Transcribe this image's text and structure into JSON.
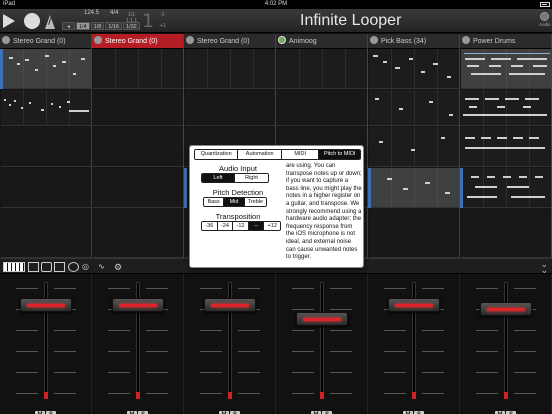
{
  "status_bar": {
    "carrier": "iPad",
    "time": "4:02 PM"
  },
  "transport": {
    "tempo": "124.5",
    "meter": "4/4",
    "quantize_options": [
      "1/4",
      "1/8",
      "1/16",
      "1/32"
    ],
    "quantize_selected": "1/4",
    "position_small": [
      "1/1",
      "1.1.1",
      "1"
    ],
    "position_big": "1",
    "length_labels": [
      "-1",
      "+1"
    ],
    "app_title": "Infinite Looper",
    "audio_label": "Audio"
  },
  "tracks": [
    {
      "name": "Stereo Grand (0)",
      "active": false,
      "icon": "gear-icon"
    },
    {
      "name": "Stereo Grand (0)",
      "active": true,
      "icon": "gear-icon"
    },
    {
      "name": "Stereo Grand (0)",
      "active": false,
      "icon": "gear-icon"
    },
    {
      "name": "Animoog",
      "active": false,
      "icon": "animoog-app-icon"
    },
    {
      "name": "Pick Bass (34)",
      "active": false,
      "icon": "gear-icon"
    },
    {
      "name": "Power Drums",
      "active": false,
      "icon": "gear-icon"
    }
  ],
  "popover": {
    "tabs": [
      "Quantization",
      "Automation",
      "MIDI",
      "Pitch to MIDI"
    ],
    "selected_tab": "Pitch to MIDI",
    "audio_input_label": "Audio Input",
    "audio_input_options": [
      "Left",
      "Right"
    ],
    "audio_input_selected": "Left",
    "pitch_detection_label": "Pitch Detection",
    "pitch_detection_options": [
      "Bass",
      "Mid",
      "Treble"
    ],
    "pitch_detection_selected": "Mid",
    "transposition_label": "Transposition",
    "transposition_options": [
      "-36",
      "-24",
      "-12",
      "--",
      "+12"
    ],
    "transposition_selected": "--",
    "help_text": "are using.  You can transpose notes up or down; if you want to capture a bass line, you might play the notes in a higher register on a guitar, and transpose. We strongly recommend using a hardware audio adapter; the frequency response from the iOS microphone is not ideal, and external noise can cause unwanted notes to trigger."
  },
  "mixer": {
    "mute_label": "M",
    "solo_label": "S",
    "fader_levels": [
      0.84,
      0.84,
      0.84,
      0.71,
      0.84,
      0.8
    ]
  },
  "colors": {
    "active_track": "#b31d23",
    "fader_led": "#e0222a",
    "selection_blue": "#3d73b4"
  }
}
